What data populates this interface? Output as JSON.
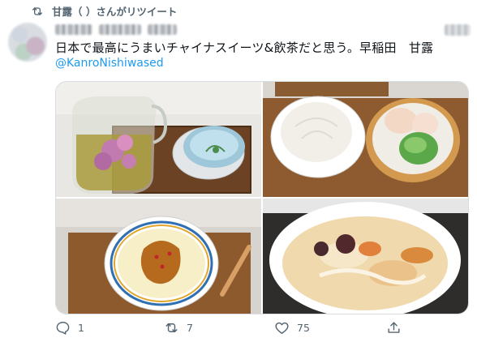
{
  "retweet": {
    "icon": "retweet-icon",
    "text": "甘露（ ）さんがリツイート"
  },
  "tweet": {
    "text": "日本で最高にうまいチャイナスイーツ&飲茶だと思う。早稲田　甘露",
    "mention": "@KanroNishiwased"
  },
  "photos": [
    {
      "subject": "flower tea pot and tea cup"
    },
    {
      "subject": "steamed bun and dumplings"
    },
    {
      "subject": "egg pudding"
    },
    {
      "subject": "dessert soup"
    }
  ],
  "actions": {
    "reply_count": "1",
    "retweet_count": "7",
    "like_count": "75"
  }
}
